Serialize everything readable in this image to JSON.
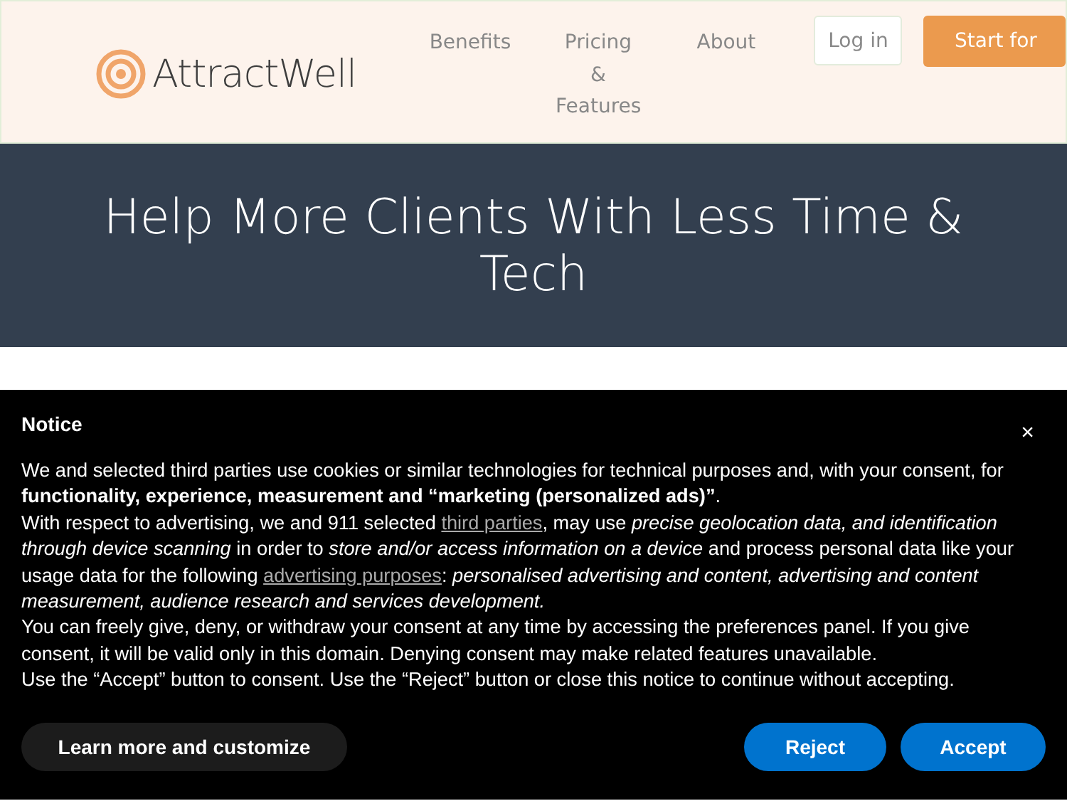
{
  "header": {
    "logo": "AttractWell",
    "nav": [
      "Benefits",
      "Pricing & Features",
      "About"
    ],
    "login": "Log in",
    "start": "Start for"
  },
  "hero": {
    "title": "Help More Clients With Less Time & Tech"
  },
  "notice": {
    "title": "Notice",
    "close": "×",
    "paragraphs": [
      [
        {
          "kind": "text",
          "text": "We and selected third parties use cookies or similar technologies for technical purposes and, with your consent, for **functionality, experience, measurement and “marketing (personalized ads)”**."
        }
      ],
      [
        {
          "kind": "text",
          "text": "With respect to advertising, we and 911 selected"
        },
        {
          "kind": "link",
          "text": "third parties"
        },
        {
          "kind": "text",
          "text": ", may use *precise geolocation data, and identification through device scanning* in order to *store and/or access information on a device* and process personal data like your usage data for the following"
        },
        {
          "kind": "link",
          "text": "advertising purposes"
        },
        {
          "kind": "text",
          "text": ": *personalised advertising and content, advertising and content measurement, audience research and services development.*"
        }
      ],
      [
        {
          "kind": "text",
          "text": "You can freely give, deny, or withdraw your consent at any time by accessing the preferences panel. If you give consent, it will be valid only in this domain. Denying consent may make related features unavailable."
        }
      ],
      [
        {
          "kind": "text",
          "text": "Use the “Accept” button to consent. Use the “Reject” button or close this notice to continue without accepting."
        }
      ]
    ],
    "buttons": [
      {
        "label": "Learn more and customize",
        "kind": "secondary"
      },
      {
        "label": "Reject",
        "kind": "primary"
      },
      {
        "label": "Accept",
        "kind": "primary"
      }
    ]
  }
}
